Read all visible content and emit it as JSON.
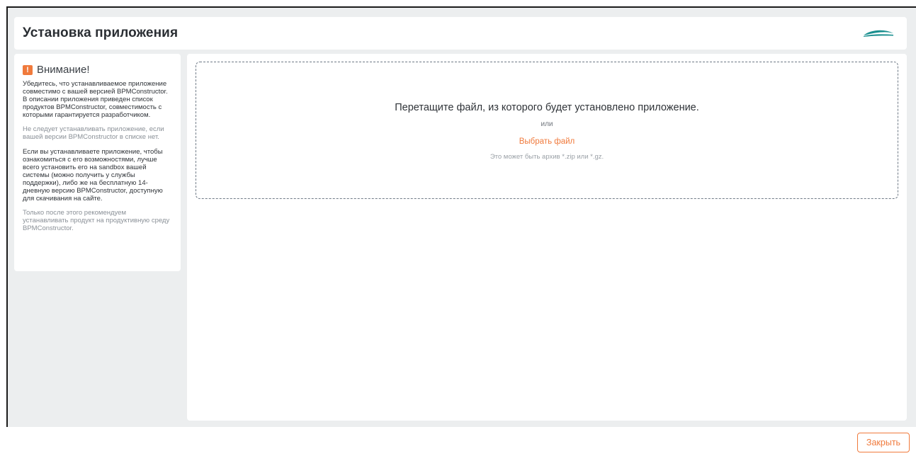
{
  "header": {
    "title": "Установка приложения",
    "logo_icon": "brand-swoosh-logo",
    "logo_color": "#1a8f8f"
  },
  "warning": {
    "icon": "exclamation-icon",
    "icon_color": "#f07a3c",
    "title": "Внимание!",
    "paragraph_1": "Убедитесь, что устанавливаемое приложение совместимо с вашей версией BPMConstructor. В описании приложения приведен список продуктов BPMConstructor, совместимость с которыми гарантируется разработчиком.",
    "paragraph_2": "Не следует устанавливать приложение, если вашей версии BPMConstructor в списке нет.",
    "paragraph_3": "Если вы устанавливаете приложение, чтобы ознакомиться с его возможностями, лучше всего установить его на sandbox вашей системы (можно получить у службы поддержки), либо же на бесплатную 14-дневную версию BPMConstructor, доступную для скачивания на сайте.",
    "paragraph_4": "Только после этого рекомендуем устанавливать продукт на продуктивную среду BPMConstructor."
  },
  "dropzone": {
    "title": "Перетащите файл, из которого будет установлено приложение.",
    "or_text": "или",
    "choose_file": "Выбрать файл",
    "hint": "Это может быть архив *.zip или *.gz."
  },
  "footer": {
    "close_label": "Закрыть",
    "accent_color": "#f07a3c"
  }
}
